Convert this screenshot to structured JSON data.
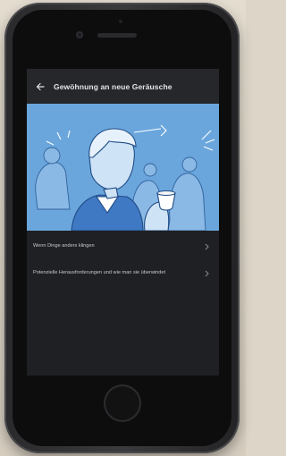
{
  "header": {
    "title": "Gewöhnung an neue Geräusche",
    "back_icon": "arrow-left-icon"
  },
  "hero": {
    "description_icon": "hero-illustration",
    "accent_color": "#6aa6dc"
  },
  "list": {
    "items": [
      {
        "label": "Wenn Dinge anders klingen",
        "icon": "chevron-right-icon"
      },
      {
        "label": "Potenzielle Herausforderungen und wie man sie überwindet",
        "icon": "chevron-right-icon"
      }
    ]
  },
  "colors": {
    "screen_bg": "#1f2024",
    "app_bar_bg": "#26272b",
    "text_primary": "#e6e6e6",
    "text_secondary": "#c9c9cc"
  }
}
